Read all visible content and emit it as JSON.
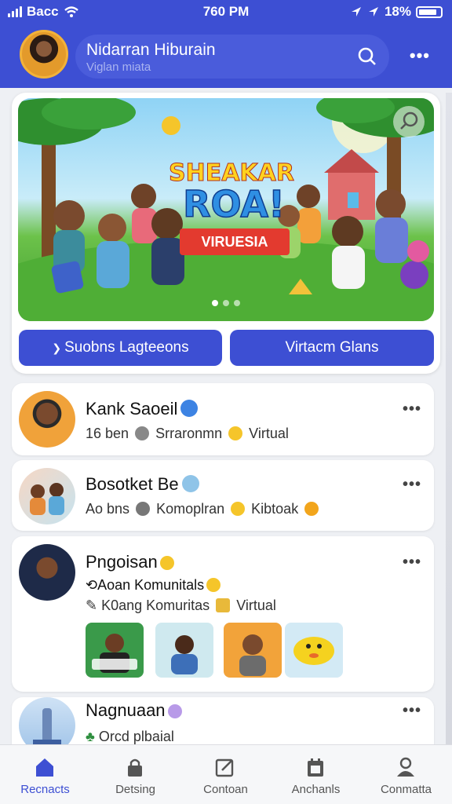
{
  "status": {
    "carrier": "Bacc",
    "time": "760 PM",
    "battery": "18%"
  },
  "header": {
    "name": "Nidarran Hiburain",
    "subtitle": "Viglan miata"
  },
  "banner": {
    "title_top": "SHEAKAR",
    "title_main": "ROA!",
    "ribbon": "VIRUESIA",
    "dots": 3,
    "active_dot": 0
  },
  "actions": {
    "left": "Suobns Lagteeons",
    "right": "Virtacm Glans"
  },
  "feed": [
    {
      "title": "Kank Saoeil",
      "sub_a": "16 ben",
      "sub_b": "Srraronmn",
      "sub_c": "Virtual"
    },
    {
      "title": "Bosotket Be",
      "sub_a": "Ao bns",
      "sub_b": "Komoplran",
      "sub_c": "Kibtoak"
    },
    {
      "title": "Pngoisan",
      "line1": "Aoan Komunitals",
      "line2_a": "K0ang Komuritas",
      "line2_b": "Virtual"
    },
    {
      "title": "Nagnuaan",
      "sub": "Orcd plbaial"
    }
  ],
  "nav": [
    {
      "label": "Recnacts",
      "icon": "home-icon",
      "active": true
    },
    {
      "label": "Detsing",
      "icon": "lock-icon",
      "active": false
    },
    {
      "label": "Contoan",
      "icon": "edit-icon",
      "active": false
    },
    {
      "label": "Anchanls",
      "icon": "calendar-icon",
      "active": false
    },
    {
      "label": "Conmatta",
      "icon": "person-icon",
      "active": false
    }
  ],
  "colors": {
    "primary": "#3d4fd3",
    "header": "#3d4fd3",
    "background": "#eef0f4"
  }
}
